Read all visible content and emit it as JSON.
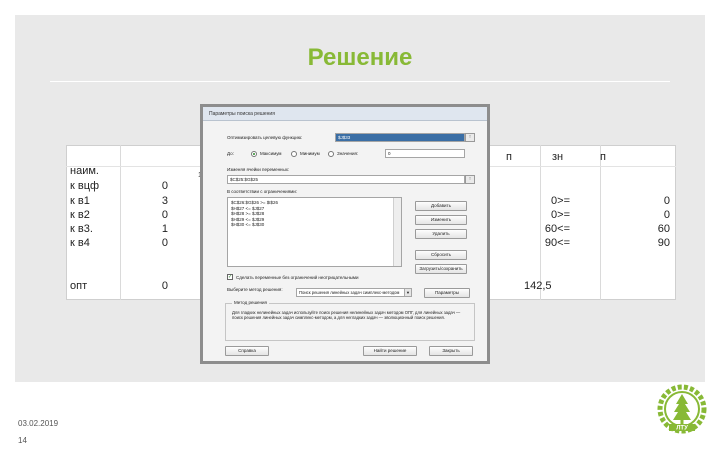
{
  "slide": {
    "title": "Решение",
    "date": "03.02.2019",
    "page_number": "14",
    "accent_color": "#88b936",
    "logo_text": "ЛТУ"
  },
  "sheet": {
    "left_labels": [
      "наим.",
      "к вцф",
      "к в1",
      "к в2",
      "к в3.",
      "к в4",
      "опт"
    ],
    "left_values": [
      "0",
      "3",
      "0",
      "1",
      "0",
      "0"
    ],
    "marker": "14",
    "right_headers": [
      "п",
      "зн",
      "п"
    ],
    "right_signs": [
      "0>=",
      "0>=",
      "60<=",
      "90<="
    ],
    "right_values": [
      "0",
      "0",
      "60",
      "90"
    ],
    "optimum": "142,5"
  },
  "dialog": {
    "title": "Параметры поиска решения",
    "objective_label": "Оптимизировать целевую функцию:",
    "objective_value": "$J$33",
    "to_label": "До:",
    "radio_max": "Максимум",
    "radio_min": "Минимум",
    "radio_value": "Значения:",
    "value_field": "0",
    "changing_label": "Изменяя ячейки переменных:",
    "changing_value": "$C$25:$G$25",
    "constraints_label": "В соответствии с ограничениями:",
    "constraints": [
      "$C$26:$G$26 >= $I$26",
      "$H$27 <= $J$27",
      "$H$28 >= $J$28",
      "$H$29 <= $J$29",
      "$H$30 <= $J$30"
    ],
    "btn_add": "Добавить",
    "btn_change": "Изменить",
    "btn_delete": "Удалить",
    "btn_reset": "Сбросить",
    "btn_load_save": "Загрузить/сохранить",
    "checkbox_label": "Сделать переменные без ограничений неотрицательными",
    "checkbox_checked": true,
    "method_label": "Выберите метод решения:",
    "method_value": "Поиск решения линейных задач симплекс-методом",
    "btn_params": "Параметры",
    "group_title": "Метод решения",
    "group_text": "Для гладких нелинейных задач используйте поиск решения нелинейных задач методом ОПГ, для линейных задач — поиск решения линейных задач симплекс-методом, а для негладких задач — эволюционный поиск решения.",
    "btn_help": "Справка",
    "btn_solve": "Найти решение",
    "btn_close": "Закрыть"
  }
}
